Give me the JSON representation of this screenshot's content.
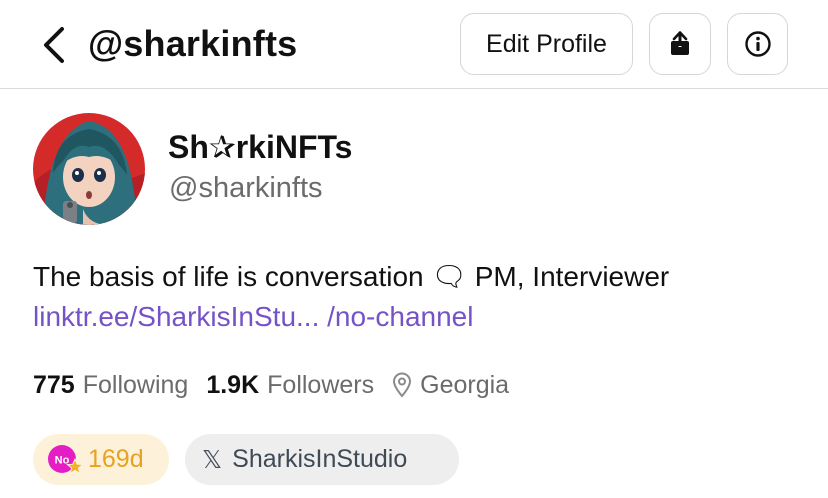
{
  "header": {
    "handle": "@sharkinfts",
    "edit_profile_label": "Edit Profile",
    "share_icon": "share-icon",
    "info_icon": "info-icon",
    "back_icon": "chevron-left-icon"
  },
  "profile": {
    "display_name": "Sh✰rkiNFTs",
    "handle": "@sharkinfts",
    "bio": "The basis of life is conversation 🗨 PM, Interviewer",
    "link": "linktr.ee/SharkisInStu... /no-channel"
  },
  "stats": {
    "following_count": "775",
    "following_label": "Following",
    "followers_count": "1.9K",
    "followers_label": "Followers",
    "location": "Georgia"
  },
  "chips": {
    "streak_badge_text": "No",
    "streak": "169d",
    "x_mark": "𝕏",
    "x_handle": "SharkisInStudio"
  },
  "colors": {
    "accent_link": "#7652c8",
    "muted_text": "#6b6b6b",
    "streak_bg": "#fdf1da",
    "streak_text": "#e8a21b",
    "badge_magenta": "#e41ec4"
  }
}
